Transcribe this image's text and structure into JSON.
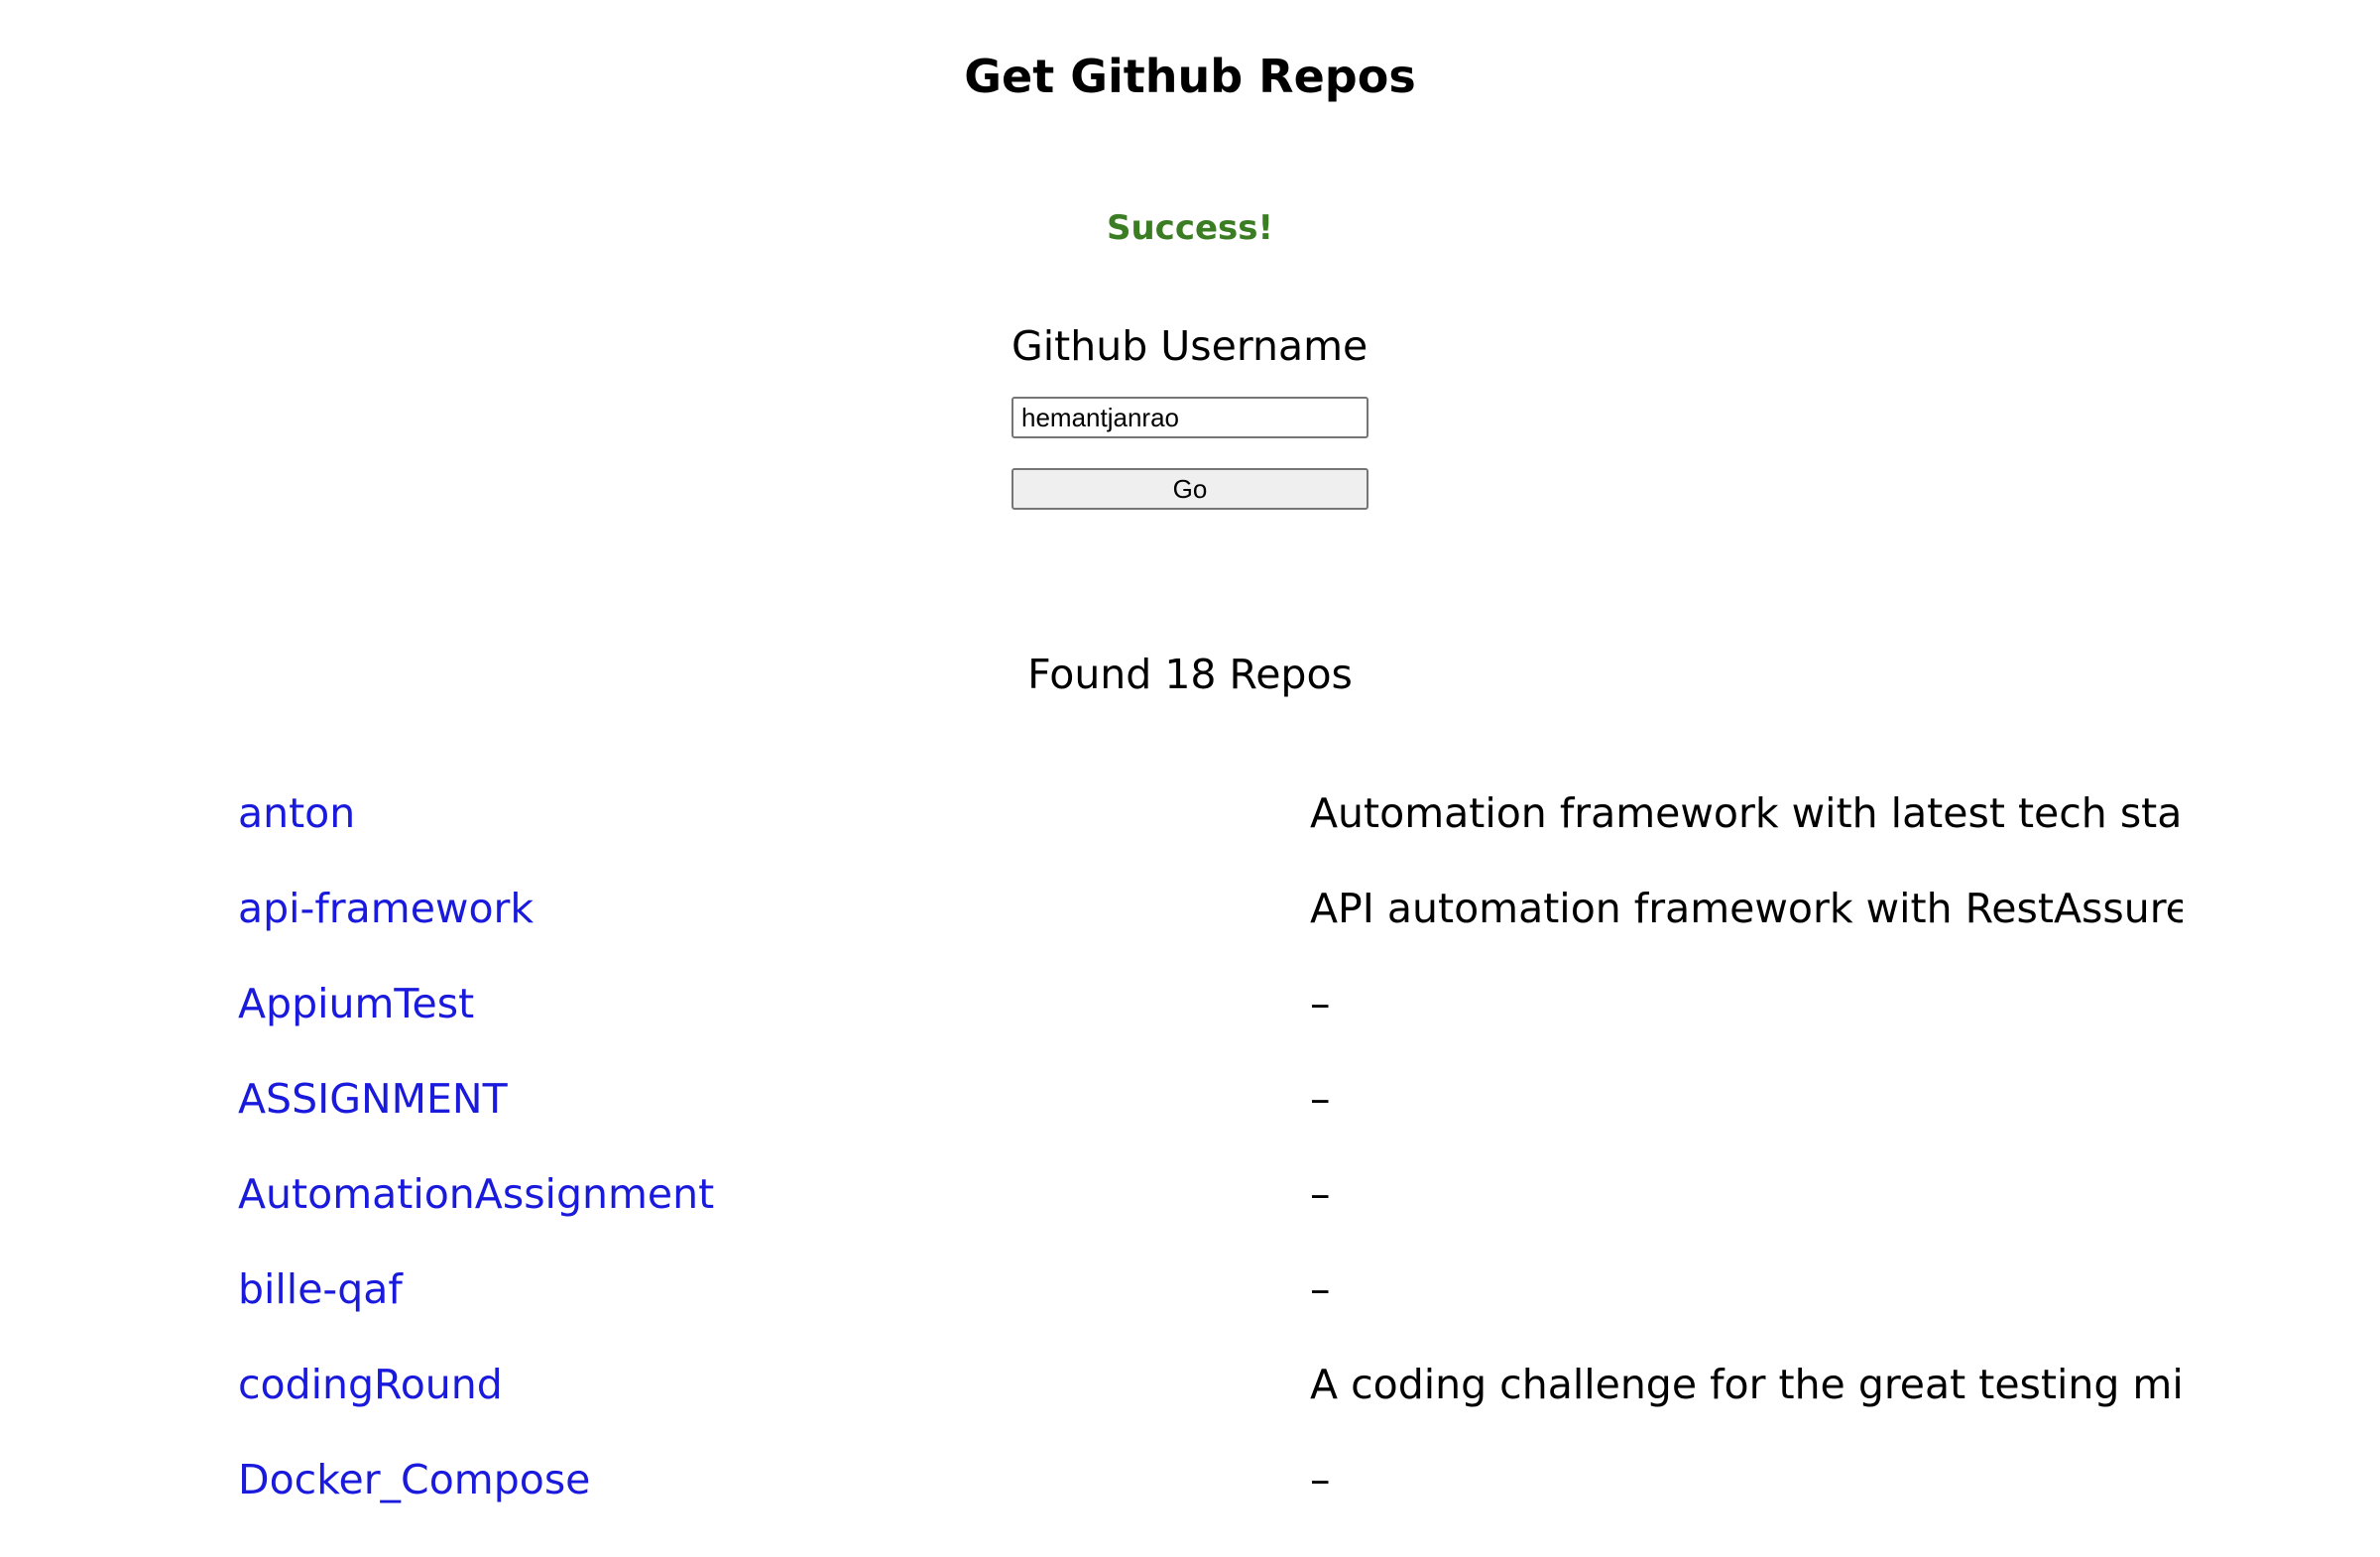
{
  "header": {
    "title": "Get Github Repos"
  },
  "status": {
    "message": "Success!",
    "color": "#3a7d22"
  },
  "form": {
    "label": "Github Username",
    "username_value": "hemantjanrao",
    "go_label": "Go"
  },
  "results": {
    "count_text": "Found 18 Repos",
    "link_color": "#1a1add",
    "repos": [
      {
        "name": "anton",
        "description": "Automation framework with latest tech stac..."
      },
      {
        "name": "api-framework",
        "description": "API automation framework with RestAssure..."
      },
      {
        "name": "AppiumTest",
        "description": "–"
      },
      {
        "name": "ASSIGNMENT",
        "description": "–"
      },
      {
        "name": "AutomationAssignment",
        "description": "–"
      },
      {
        "name": "bille-qaf",
        "description": "–"
      },
      {
        "name": "codingRound",
        "description": "A coding challenge for the great testing mi..."
      },
      {
        "name": "Docker_Compose",
        "description": "–"
      }
    ]
  }
}
